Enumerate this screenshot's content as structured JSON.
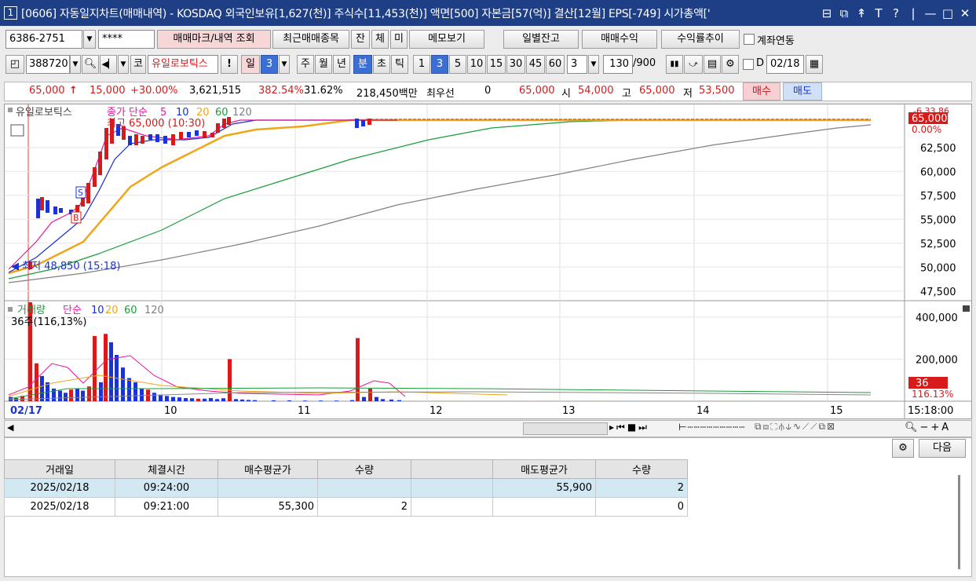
{
  "window": {
    "num": "1",
    "title": "[0606] 자동일지차트(매매내역) - KOSDAQ 외국인보유[1,627(천)] 주식수[11,453(천)] 액면[500] 자본금[57(억)] 결산[12월] EPS[-749] 시가총액['"
  },
  "toolbar1": {
    "account": "6386-2751",
    "password": "****",
    "mark_btn": "매매마크/내역 조회",
    "recent_btn": "최근매매종목",
    "jan": "잔",
    "che": "체",
    "mi": "미",
    "memo": "메모보기",
    "daily": "일별잔고",
    "trade_profit": "매매수익",
    "profit_trend": "수익률추이",
    "link": "계좌연동"
  },
  "toolbar2": {
    "code": "388720",
    "ko": "코",
    "stock_name": "유일로보틱스",
    "excl": "!",
    "il": "일",
    "il_num": "3",
    "ju": "주",
    "wol": "월",
    "nyeon": "년",
    "bun": "분",
    "cho": "초",
    "tik": "틱",
    "periods": [
      "1",
      "3",
      "5",
      "10",
      "15",
      "30",
      "45",
      "60"
    ],
    "sel_period": "3",
    "unit": "3",
    "count": "130",
    "total": "/900",
    "d": "D",
    "date": "02/18"
  },
  "quote": {
    "price": "65,000",
    "arrow": "↑",
    "change": "15,000",
    "pct": "+30.00%",
    "volume": "3,621,515",
    "vol_ratio": "382.54%",
    "turnover": "31.62%",
    "amount": "218,450백만",
    "best_label": "최우선",
    "best_val": "0",
    "ask": "65,000",
    "si_label": "시",
    "si": "54,000",
    "go_label": "고",
    "go": "65,000",
    "jeo_label": "저",
    "jeo": "53,500",
    "buy": "매수",
    "sell": "매도"
  },
  "chart_labels": {
    "legend_name": "유일로보틱스",
    "legend_rest": "종가 단순",
    "ma": [
      "5",
      "10",
      "20",
      "60",
      "120"
    ],
    "high": "최고 65,000 (10:30)",
    "low": "최저 48,850 (15:18)",
    "s": "S",
    "b": "B",
    "vol_legend": "거래량",
    "vol_ma_label": "단순",
    "vol_info": "36주(116,13%)",
    "pct_top": "0.00%",
    "pct_top2": "-6.33.86",
    "vol_last": "36",
    "vol_pct": "116.13%",
    "price_tag": "65,000",
    "last_time": "15:18:00"
  },
  "chart_data": {
    "type": "line",
    "title": "",
    "x": [
      "02/17",
      "10",
      "11",
      "12",
      "13",
      "14",
      "15"
    ],
    "y_axis_price": [
      "62,500",
      "60,000",
      "57,500",
      "55,000",
      "52,500",
      "50,000",
      "47,500"
    ],
    "ylim_price": [
      46500,
      66500
    ],
    "y_axis_volume": [
      "400,000",
      "200,000"
    ],
    "ylim_volume": [
      0,
      470000
    ],
    "series": [
      {
        "name": "5",
        "color": "#e4189b"
      },
      {
        "name": "10",
        "color": "#1a2fcc"
      },
      {
        "name": "20",
        "color": "#f0a61a"
      },
      {
        "name": "60",
        "color": "#1a9c3a"
      },
      {
        "name": "120",
        "color": "#808080"
      }
    ]
  },
  "bottom": {
    "next_btn": "다음",
    "headers": [
      "거래일",
      "체결시간",
      "매수평균가",
      "수량",
      "",
      "매도평균가",
      "수량"
    ],
    "rows": [
      [
        "2025/02/18",
        "09:24:00",
        "",
        "",
        "",
        "55,900",
        "2"
      ],
      [
        "2025/02/18",
        "09:21:00",
        "55,300",
        "2",
        "",
        "",
        "0"
      ]
    ]
  }
}
